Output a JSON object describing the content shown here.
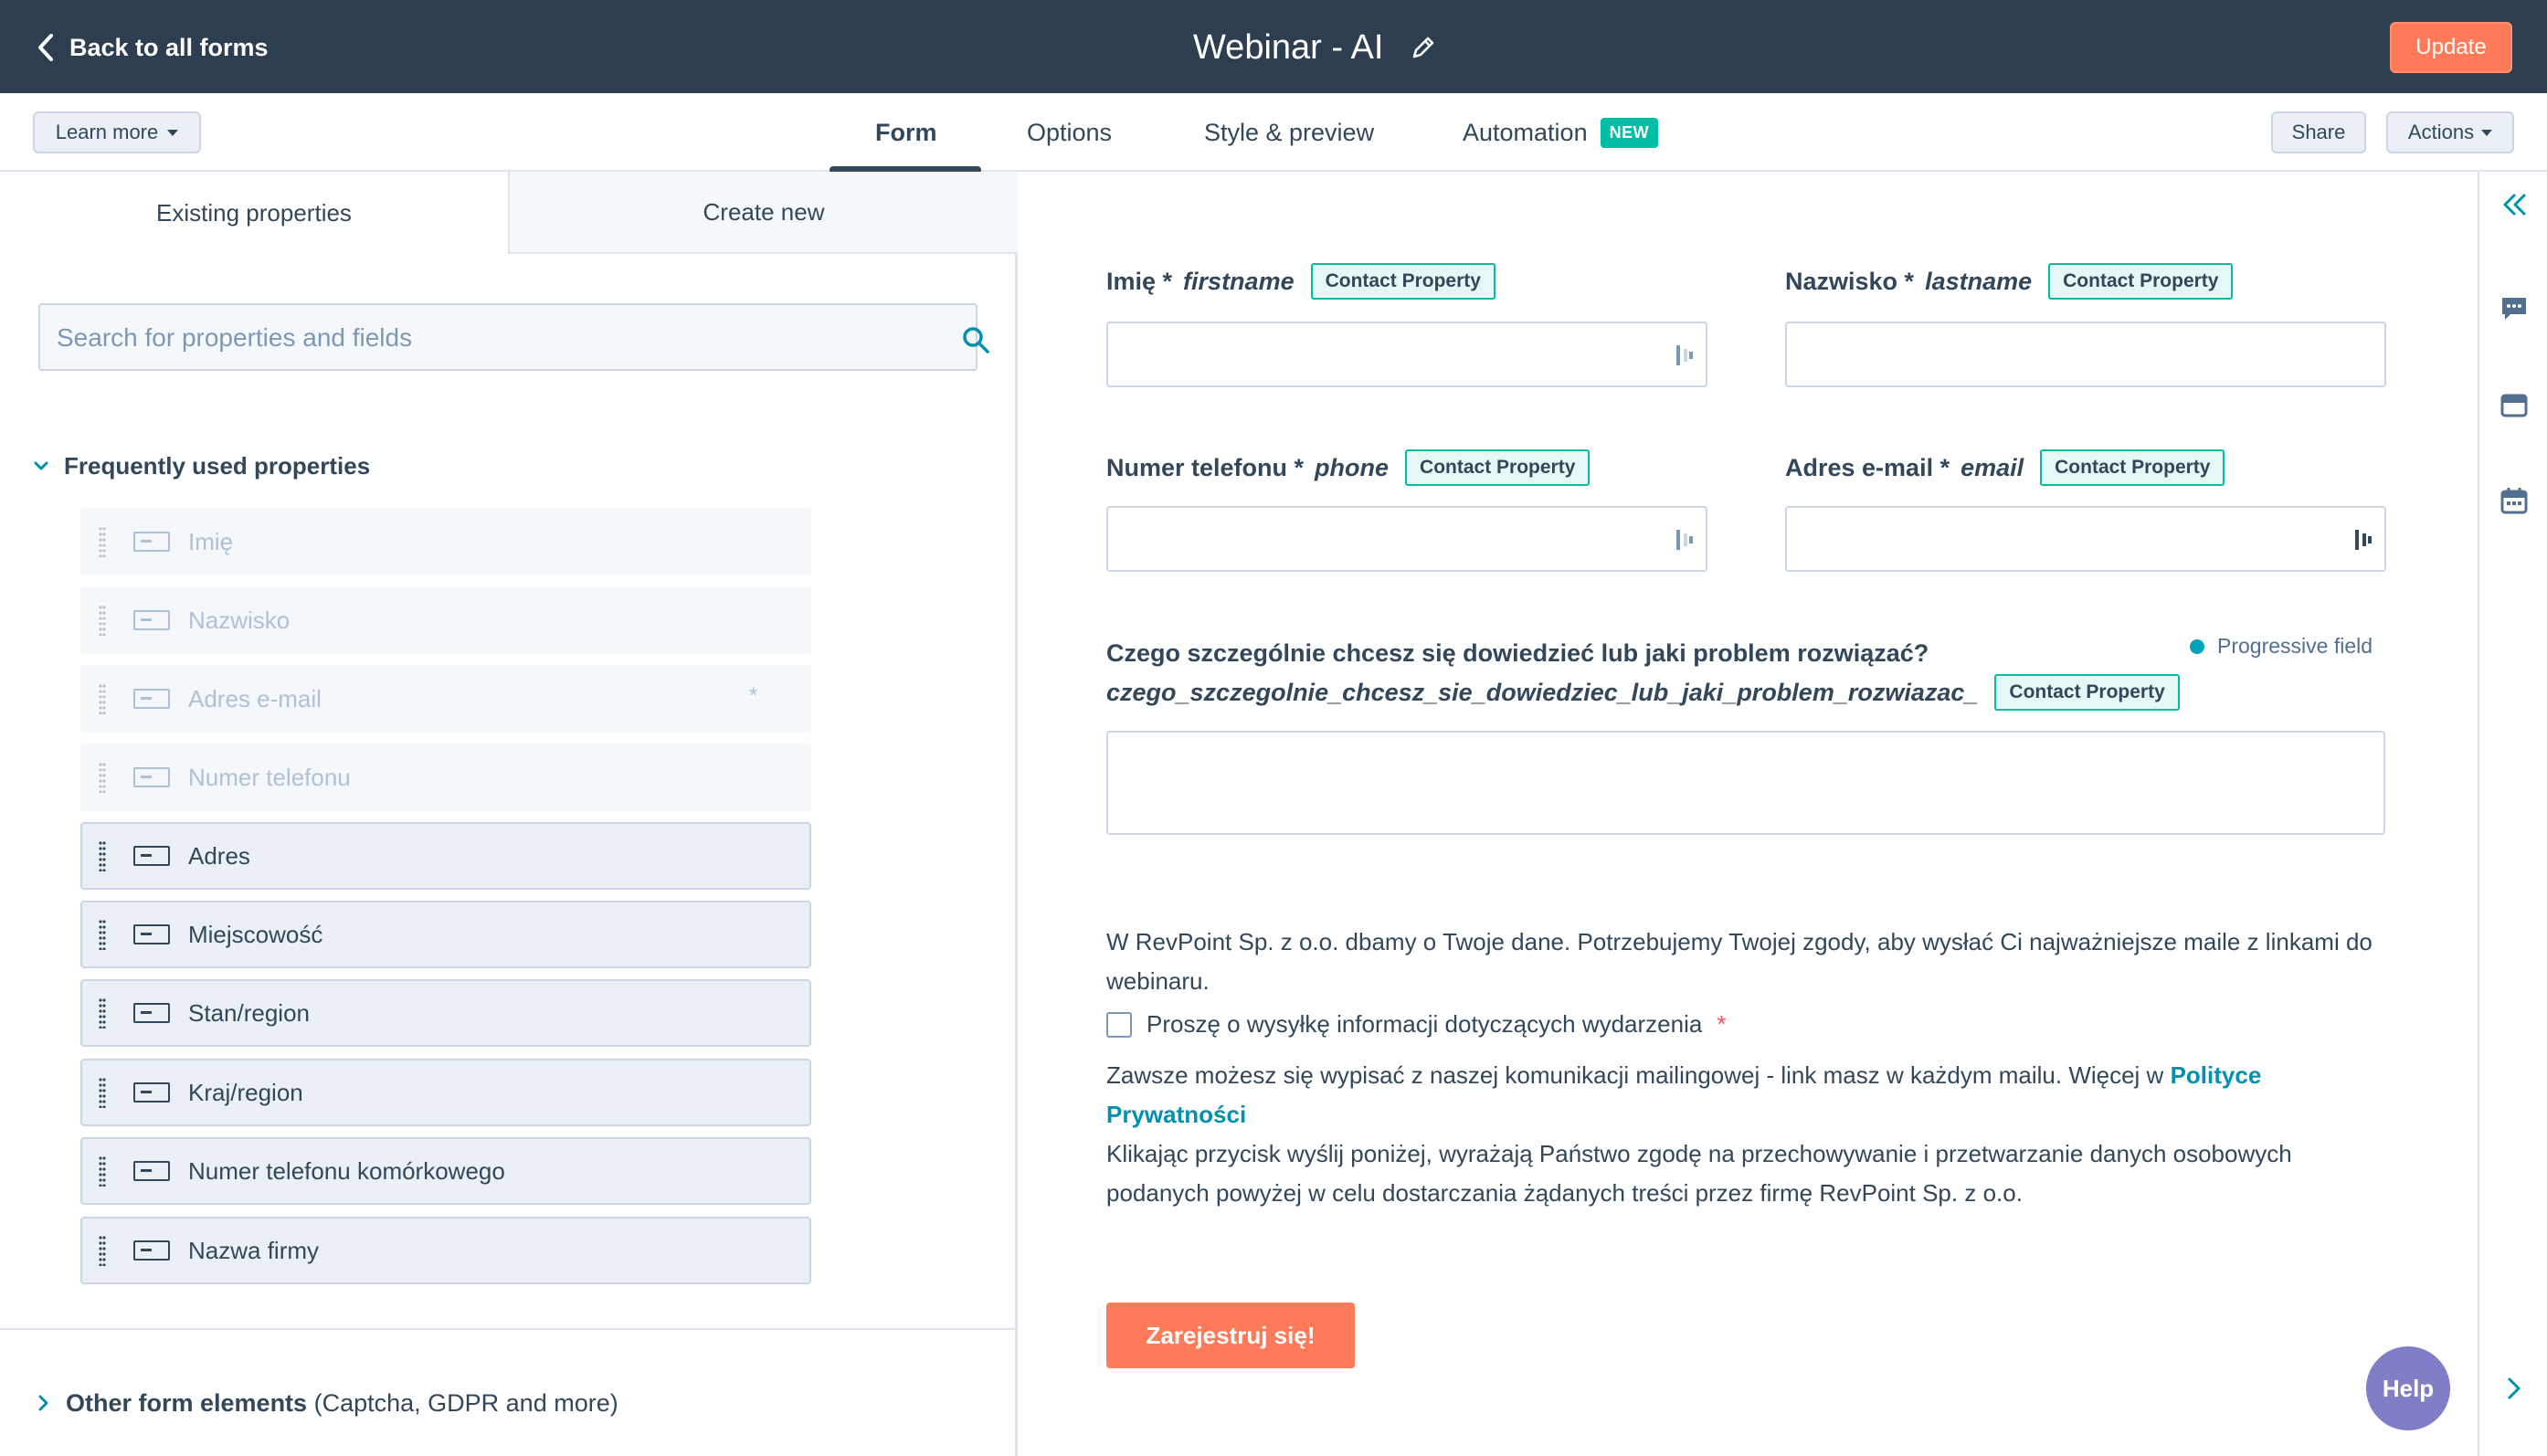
{
  "header": {
    "back_label": "Back to all forms",
    "form_title": "Webinar - AI",
    "update_label": "Update"
  },
  "subnav": {
    "learn_more_label": "Learn more",
    "tabs": [
      {
        "label": "Form"
      },
      {
        "label": "Options"
      },
      {
        "label": "Style & preview"
      },
      {
        "label": "Automation",
        "badge": "NEW"
      }
    ],
    "share_label": "Share",
    "actions_label": "Actions"
  },
  "left_panel": {
    "tab_existing": "Existing properties",
    "tab_create": "Create new",
    "search_placeholder": "Search for properties and fields",
    "section_title": "Frequently used properties",
    "properties": [
      {
        "label": "Imię",
        "state": "used"
      },
      {
        "label": "Nazwisko",
        "state": "used"
      },
      {
        "label": "Adres e-mail",
        "state": "used",
        "required_mark": "*"
      },
      {
        "label": "Numer telefonu",
        "state": "used"
      },
      {
        "label": "Adres",
        "state": "available"
      },
      {
        "label": "Miejscowość",
        "state": "available"
      },
      {
        "label": "Stan/region",
        "state": "available"
      },
      {
        "label": "Kraj/region",
        "state": "available"
      },
      {
        "label": "Numer telefonu komórkowego",
        "state": "available"
      },
      {
        "label": "Nazwa firmy",
        "state": "available"
      }
    ],
    "other_title": "Other form elements",
    "other_subtitle": "(Captcha, GDPR and more)"
  },
  "form": {
    "fields": [
      {
        "label": "Imię *",
        "internal": "firstname",
        "tag": "Contact Property"
      },
      {
        "label": "Nazwisko *",
        "internal": "lastname",
        "tag": "Contact Property"
      },
      {
        "label": "Numer telefonu *",
        "internal": "phone",
        "tag": "Contact Property"
      },
      {
        "label": "Adres e-mail *",
        "internal": "email",
        "tag": "Contact Property"
      }
    ],
    "question": {
      "label": "Czego szczególnie chcesz się dowiedzieć lub jaki problem rozwiązać?",
      "internal": "czego_szczegolnie_chcesz_sie_dowiedziec_lub_jaki_problem_rozwiazac_",
      "tag": "Contact Property",
      "progressive_label": "Progressive field"
    },
    "consent_text": "W RevPoint Sp. z o.o. dbamy o Twoje dane.  Potrzebujemy Twojej zgody, aby wysłać Ci najważniejsze maile z linkami do webinaru.",
    "checkbox_label": "Proszę o wysyłkę informacji dotyczących wydarzenia",
    "checkbox_required": "*",
    "unsubscribe_text": "Zawsze możesz się wypisać z naszej komunikacji mailingowej -  link masz w każdym mailu. Więcej w",
    "privacy_link": "Polityce Prywatności",
    "processing_text": "Klikając przycisk wyślij poniżej, wyrażają Państwo zgodę na przechowywanie i przetwarzanie danych osobowych podanych powyżej w celu dostarczania żądanych treści przez firmę RevPoint Sp. z o.o.",
    "submit_label": "Zarejestruj się!"
  },
  "help_label": "Help",
  "colors": {
    "header_bg": "#2d3e50",
    "accent_orange": "#ff7a59",
    "teal": "#00bda5",
    "link": "#0091ae"
  },
  "icons": [
    "chevron-left-icon",
    "pencil-icon",
    "search-icon",
    "chevron-down-icon",
    "chevron-right-icon",
    "drag-handle-icon",
    "text-field-icon",
    "double-chevron-left-icon",
    "chat-icon",
    "inbox-icon",
    "calendar-icon"
  ]
}
